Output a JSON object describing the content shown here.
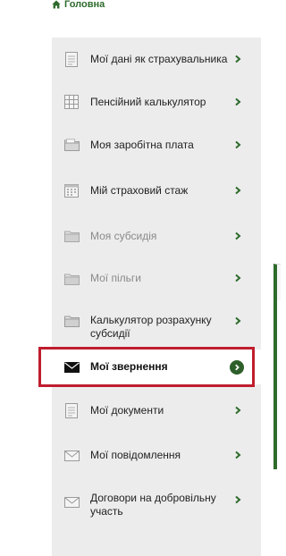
{
  "breadcrumb": {
    "home_label": "Головна"
  },
  "menu": {
    "items": [
      {
        "label": "Мої дані як страхувальника",
        "icon": "document-icon",
        "state": "normal"
      },
      {
        "label": "Пенсійний калькулятор",
        "icon": "calculator-icon",
        "state": "normal"
      },
      {
        "label": "Моя заробітна плата",
        "icon": "folder-icon",
        "state": "normal"
      },
      {
        "label": "Мій страховий стаж",
        "icon": "calendar-icon",
        "state": "normal"
      },
      {
        "label": "Моя субсидія",
        "icon": "folder-icon",
        "state": "disabled"
      },
      {
        "label": "Мої пільги",
        "icon": "folder-icon",
        "state": "disabled"
      },
      {
        "label": "Калькулятор розрахунку субсидії",
        "icon": "folder-icon",
        "state": "normal"
      },
      {
        "label": "Мої звернення",
        "icon": "envelope-icon",
        "state": "active"
      },
      {
        "label": "Мої документи",
        "icon": "document-icon",
        "state": "normal"
      },
      {
        "label": "Мої повідомлення",
        "icon": "envelope-icon",
        "state": "normal"
      },
      {
        "label": "Договори на добровільну участь",
        "icon": "envelope-icon",
        "state": "normal"
      }
    ]
  },
  "colors": {
    "accent_green": "#2e6b2b",
    "highlight_red": "#c01d2e",
    "menu_bg": "#ececec"
  }
}
